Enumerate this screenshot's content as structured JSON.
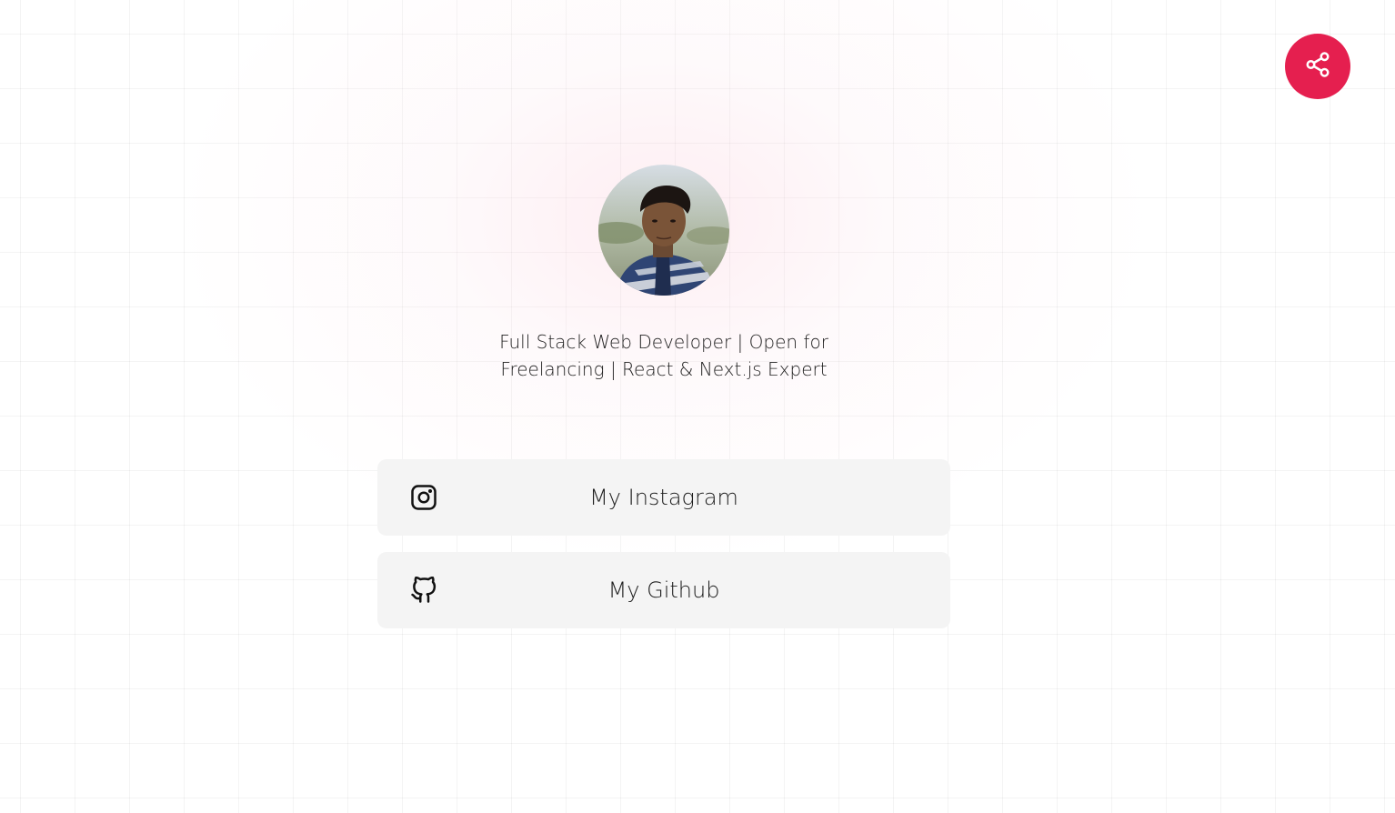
{
  "share": {
    "icon": "share-icon",
    "color": "#e51f4f"
  },
  "profile": {
    "avatar_alt": "profile photo",
    "bio_line1": "Full Stack Web Developer | Open for",
    "bio_line2": "Freelancing | React & Next.js Expert"
  },
  "links": [
    {
      "label": "My Instagram",
      "icon": "instagram-icon"
    },
    {
      "label": "My Github",
      "icon": "github-icon"
    }
  ],
  "theme": {
    "accent": "#e51f4f",
    "card_bg": "#f4f4f4"
  }
}
